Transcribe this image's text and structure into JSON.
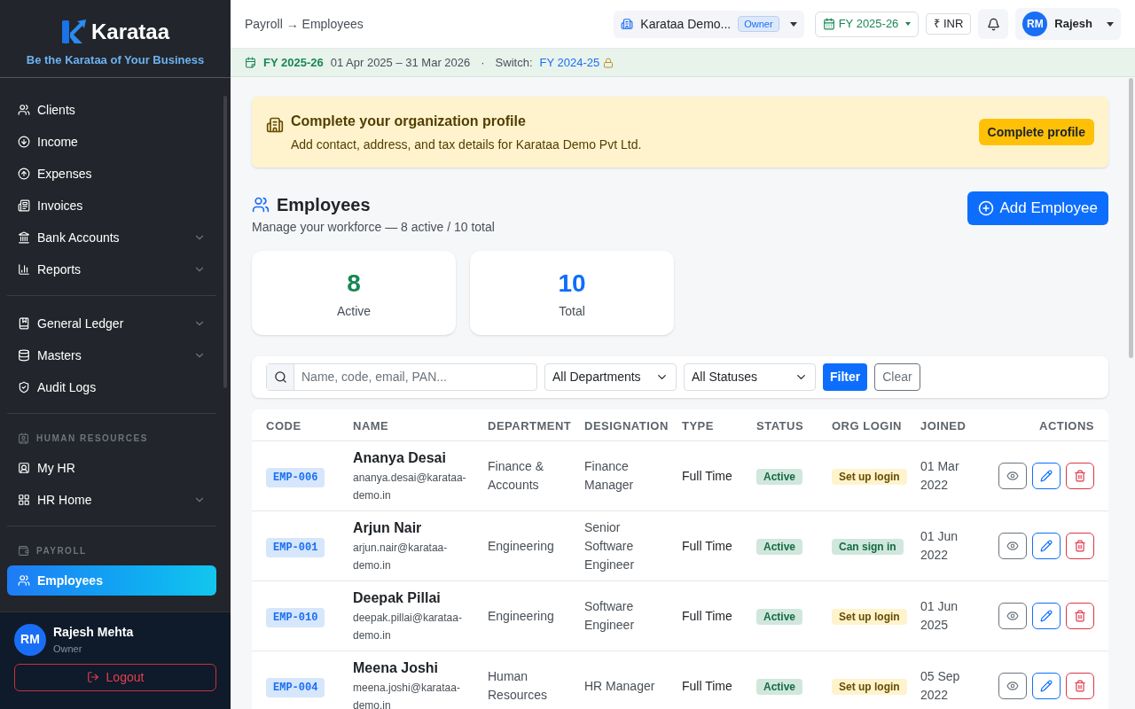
{
  "brand": {
    "name": "Karataa",
    "tagline": "Be the Karataa of Your Business"
  },
  "sidebar": {
    "sections": [
      {
        "items": [
          {
            "label": "Clients",
            "expandable": false,
            "selected": false
          },
          {
            "label": "Income",
            "expandable": false,
            "selected": false
          },
          {
            "label": "Expenses",
            "expandable": false,
            "selected": false
          },
          {
            "label": "Invoices",
            "expandable": false,
            "selected": false
          },
          {
            "label": "Bank Accounts",
            "expandable": true,
            "selected": false
          },
          {
            "label": "Reports",
            "expandable": true,
            "selected": false
          }
        ]
      },
      {
        "items": [
          {
            "label": "General Ledger",
            "expandable": true,
            "selected": false
          },
          {
            "label": "Masters",
            "expandable": true,
            "selected": false
          },
          {
            "label": "Audit Logs",
            "expandable": false,
            "selected": false
          }
        ]
      },
      {
        "heading": "HUMAN RESOURCES",
        "items": [
          {
            "label": "My HR",
            "expandable": false,
            "selected": false
          },
          {
            "label": "HR Home",
            "expandable": true,
            "selected": false
          }
        ]
      },
      {
        "heading": "PAYROLL",
        "items": [
          {
            "label": "Employees",
            "expandable": false,
            "selected": true
          }
        ]
      }
    ]
  },
  "user": {
    "initials": "RM",
    "name": "Rajesh Mehta",
    "role": "Owner",
    "logout": "Logout"
  },
  "header": {
    "breadcrumb": "Payroll → Employees",
    "org": "Karataa Demo...",
    "org_role": "Owner",
    "fy": "FY 2025-26",
    "currency": "₹ INR",
    "user_initials": "RM",
    "user_name": "Rajesh"
  },
  "fy_bar": {
    "fy": "FY 2025-26",
    "range": "01 Apr 2025 – 31 Mar 2026",
    "separator": "·",
    "switch_label": "Switch:",
    "switch_fy": "FY 2024-25",
    "locked": true
  },
  "notice": {
    "title": "Complete your organization profile",
    "text": "Add contact, address, and tax details for Karataa Demo Pvt Ltd.",
    "button": "Complete profile"
  },
  "page": {
    "title": "Employees",
    "subtitle": "Manage your workforce — 8 active / 10 total",
    "add_button": "Add Employee"
  },
  "stats": [
    {
      "value": "8",
      "label": "Active",
      "color": "#198754"
    },
    {
      "value": "10",
      "label": "Total",
      "color": "#0d6efd"
    }
  ],
  "filters": {
    "search_placeholder": "Name, code, email, PAN...",
    "department": "All Departments",
    "status": "All Statuses",
    "filter_button": "Filter",
    "clear_button": "Clear"
  },
  "table": {
    "columns": [
      "CODE",
      "NAME",
      "DEPARTMENT",
      "DESIGNATION",
      "TYPE",
      "STATUS",
      "ORG LOGIN",
      "JOINED",
      "ACTIONS"
    ],
    "rows": [
      {
        "code": "EMP-006",
        "name": "Ananya Desai",
        "email": "ananya.desai@karataa-demo.in",
        "department": "Finance & Accounts",
        "designation": "Finance Manager",
        "type": "Full Time",
        "status": "Active",
        "org_login": {
          "label": "Set up login",
          "kind": "pending"
        },
        "joined": "01 Mar 2022"
      },
      {
        "code": "EMP-001",
        "name": "Arjun Nair",
        "email": "arjun.nair@karataa-demo.in",
        "department": "Engineering",
        "designation": "Senior Software Engineer",
        "type": "Full Time",
        "status": "Active",
        "org_login": {
          "label": "Can sign in",
          "kind": "ok"
        },
        "joined": "01 Jun 2022"
      },
      {
        "code": "EMP-010",
        "name": "Deepak Pillai",
        "email": "deepak.pillai@karataa-demo.in",
        "department": "Engineering",
        "designation": "Software Engineer",
        "type": "Full Time",
        "status": "Active",
        "org_login": {
          "label": "Set up login",
          "kind": "pending"
        },
        "joined": "01 Jun 2025"
      },
      {
        "code": "EMP-004",
        "name": "Meena Joshi",
        "email": "meena.joshi@karataa-demo.in",
        "department": "Human Resources",
        "designation": "HR Manager",
        "type": "Full Time",
        "status": "Active",
        "org_login": {
          "label": "Set up login",
          "kind": "pending"
        },
        "joined": "05 Sep 2022"
      }
    ]
  }
}
